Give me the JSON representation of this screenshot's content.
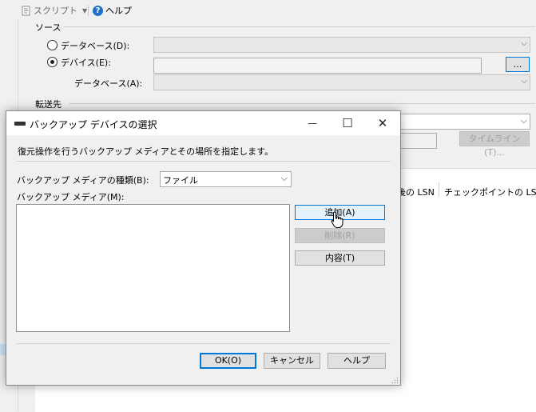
{
  "toolbar": {
    "script_label": "スクリプト",
    "help_label": "ヘルプ"
  },
  "source": {
    "section_label": "ソース",
    "database_radio_label": "データベース(D):",
    "device_radio_label": "デバイス(E):",
    "device_browse_label": "...",
    "device_database_label": "データベース(A):"
  },
  "destination": {
    "section_label": "転送先",
    "timeline_button_label": "タイムライン(T)..."
  },
  "grid": {
    "partial_col_label": "後の LSN",
    "checkpoint_col_label": "チェックポイントの LSN"
  },
  "dialog": {
    "title": "バックアップ デバイスの選択",
    "description": "復元操作を行うバックアップ メディアとその場所を指定します。",
    "media_type_label": "バックアップ メディアの種類(B):",
    "media_type_value": "ファイル",
    "media_label": "バックアップ メディア(M):",
    "add_label": "追加(A)",
    "remove_label": "削除(R)",
    "contents_label": "内容(T)",
    "ok_label": "OK(O)",
    "cancel_label": "キャンセル",
    "help_label": "ヘルプ",
    "minimize_glyph": "—",
    "maximize_glyph": "☐",
    "close_glyph": "✕"
  }
}
